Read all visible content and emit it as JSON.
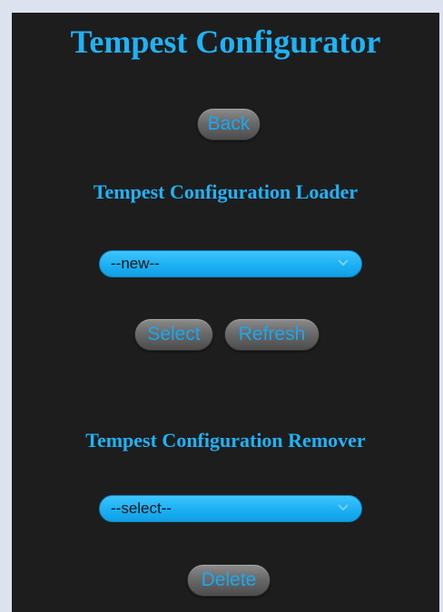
{
  "title": "Tempest Configurator",
  "back_button": "Back",
  "loader": {
    "heading": "Tempest Configuration Loader",
    "selected_value": "--new--",
    "select_button": "Select",
    "refresh_button": "Refresh"
  },
  "remover": {
    "heading": "Tempest Configuration Remover",
    "selected_value": "--select--",
    "delete_button": "Delete"
  },
  "colors": {
    "heading": "#1fb3f5",
    "panel_background": "#1d1d1d",
    "page_background": "#dde3ee",
    "select_background": "#19aef3",
    "button_text": "#1aa8f0"
  },
  "icons": {
    "dropdown": "chevron-down-icon"
  }
}
